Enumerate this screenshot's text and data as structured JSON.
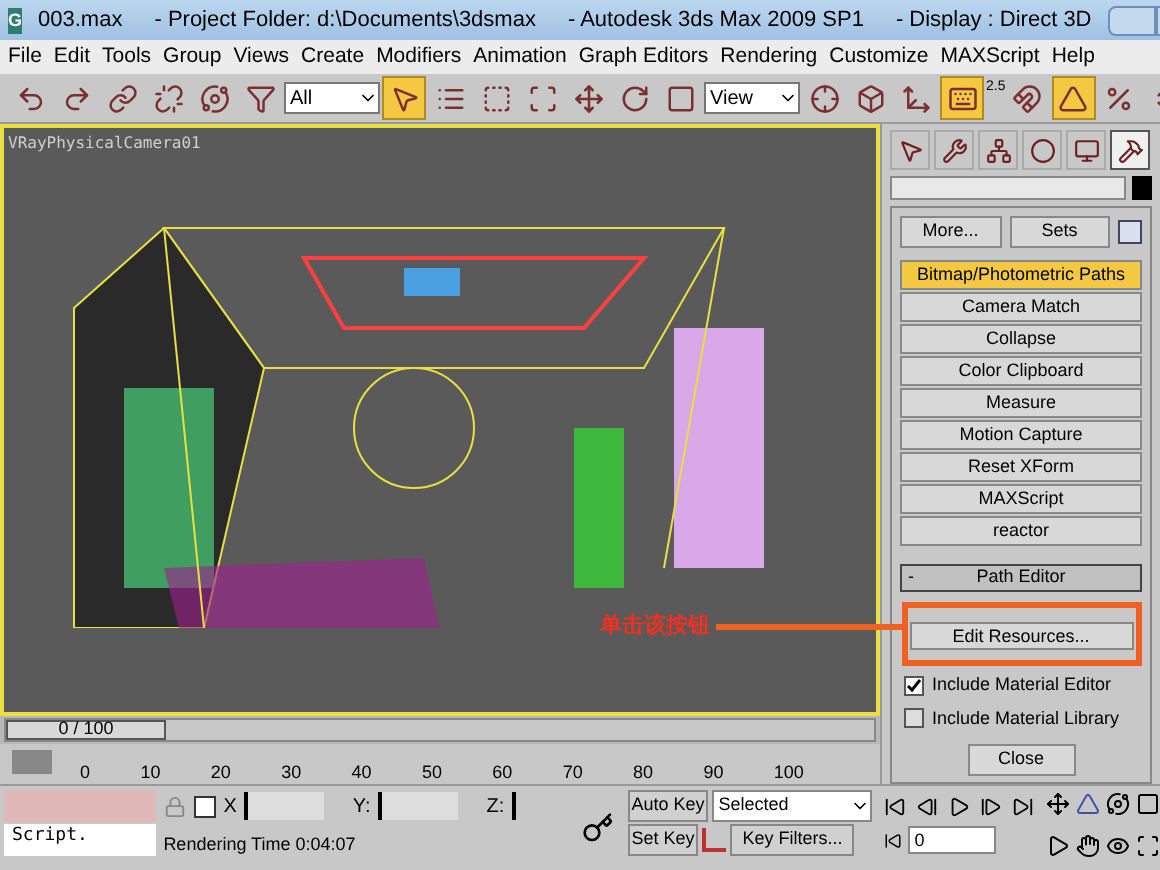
{
  "window": {
    "icon": "G",
    "file": "003.max",
    "project": "- Project Folder: d:\\Documents\\3dsmax",
    "app": "- Autodesk 3ds Max  2009 SP1",
    "display": "- Display : Direct 3D"
  },
  "menu": [
    "File",
    "Edit",
    "Tools",
    "Group",
    "Views",
    "Create",
    "Modifiers",
    "Animation",
    "Graph Editors",
    "Rendering",
    "Customize",
    "MAXScript",
    "Help"
  ],
  "toolbar": {
    "selection_filter": "All",
    "coordinate_system": "View",
    "snap_value": "2.5",
    "tools": [
      {
        "kind": "undo",
        "active": false
      },
      {
        "kind": "redo",
        "active": false
      },
      {
        "kind": "link",
        "active": false
      },
      {
        "kind": "unlink",
        "active": false
      },
      {
        "kind": "bind",
        "active": false
      },
      {
        "kind": "filter",
        "active": false
      },
      {
        "kind": "select",
        "active": true
      },
      {
        "kind": "byname",
        "active": false
      },
      {
        "kind": "region",
        "active": false
      },
      {
        "kind": "window",
        "active": false
      },
      {
        "kind": "move",
        "active": false
      },
      {
        "kind": "rotate",
        "active": false
      },
      {
        "kind": "scale",
        "active": false
      },
      {
        "kind": "coord",
        "active": false
      },
      {
        "kind": "pivot",
        "active": false
      },
      {
        "kind": "manip",
        "active": false
      },
      {
        "kind": "keyboard",
        "active": true
      },
      {
        "kind": "snap",
        "active": false
      },
      {
        "kind": "angle",
        "active": true
      },
      {
        "kind": "percent",
        "active": false
      },
      {
        "kind": "spinner",
        "active": false
      }
    ]
  },
  "viewport": {
    "label": "VRayPhysicalCamera01"
  },
  "command_panel": {
    "tabs": [
      {
        "kind": "create",
        "selected": false
      },
      {
        "kind": "modify",
        "selected": false
      },
      {
        "kind": "hierarchy",
        "selected": false
      },
      {
        "kind": "motion",
        "selected": false
      },
      {
        "kind": "display",
        "selected": false
      },
      {
        "kind": "utilities",
        "selected": true
      }
    ],
    "more": "More...",
    "sets": "Sets",
    "utilities": [
      {
        "label": "Bitmap/Photometric Paths",
        "selected": true
      },
      {
        "label": "Camera Match",
        "selected": false
      },
      {
        "label": "Collapse",
        "selected": false
      },
      {
        "label": "Color Clipboard",
        "selected": false
      },
      {
        "label": "Measure",
        "selected": false
      },
      {
        "label": "Motion Capture",
        "selected": false
      },
      {
        "label": "Reset XForm",
        "selected": false
      },
      {
        "label": "MAXScript",
        "selected": false
      },
      {
        "label": "reactor",
        "selected": false
      }
    ],
    "rollout": {
      "toggle": "-",
      "title": "Path Editor",
      "edit_button": "Edit Resources...",
      "options": [
        {
          "label": "Include Material Editor",
          "checked": true
        },
        {
          "label": "Include Material Library",
          "checked": false
        }
      ],
      "close": "Close"
    }
  },
  "annotation": "单击该按钮",
  "time_slider": {
    "label": "0 / 100",
    "level": 0
  },
  "ruler": [
    "0",
    "10",
    "20",
    "30",
    "40",
    "50",
    "60",
    "70",
    "80",
    "90",
    "100"
  ],
  "status": {
    "script": "Script.",
    "x": "X",
    "y": "Y:",
    "z": "Z:",
    "rendering_time": "Rendering Time  0:04:07",
    "auto_key": "Auto Key",
    "set_key": "Set Key",
    "key_mode": "Selected",
    "key_filters": "Key Filters...",
    "frame": "0"
  }
}
